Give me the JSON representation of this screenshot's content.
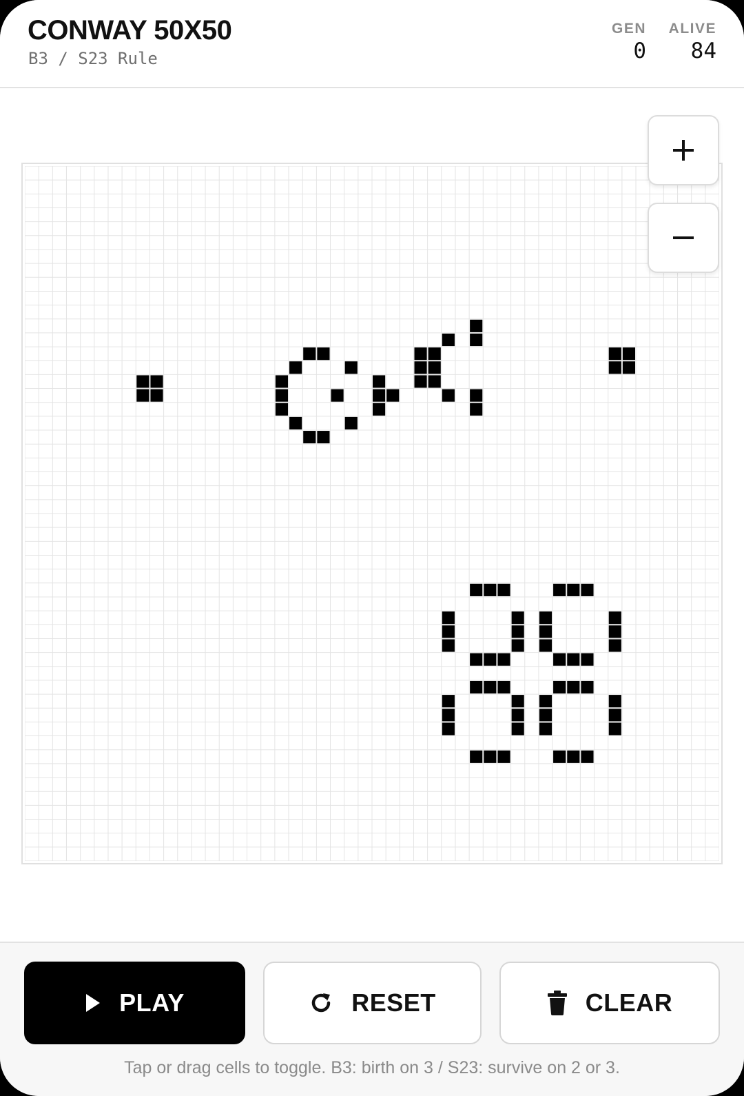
{
  "header": {
    "title": "CONWAY 50X50",
    "subtitle": "B3 / S23 Rule",
    "stats": {
      "gen_label": "GEN",
      "gen_value": "0",
      "alive_label": "ALIVE",
      "alive_value": "84"
    }
  },
  "board": {
    "cols": 50,
    "rows": 50,
    "alive_color": "#000000",
    "grid_color": "#e4e4e4",
    "live_cells": [
      [
        8,
        15
      ],
      [
        8,
        16
      ],
      [
        9,
        15
      ],
      [
        9,
        16
      ],
      [
        20,
        13
      ],
      [
        21,
        13
      ],
      [
        19,
        14
      ],
      [
        23,
        14
      ],
      [
        18,
        15
      ],
      [
        25,
        15
      ],
      [
        18,
        16
      ],
      [
        22,
        16
      ],
      [
        25,
        16
      ],
      [
        26,
        16
      ],
      [
        18,
        17
      ],
      [
        25,
        17
      ],
      [
        19,
        18
      ],
      [
        23,
        18
      ],
      [
        20,
        19
      ],
      [
        21,
        19
      ],
      [
        32,
        11
      ],
      [
        30,
        12
      ],
      [
        32,
        12
      ],
      [
        28,
        13
      ],
      [
        29,
        13
      ],
      [
        28,
        14
      ],
      [
        29,
        14
      ],
      [
        28,
        15
      ],
      [
        29,
        15
      ],
      [
        30,
        16
      ],
      [
        32,
        16
      ],
      [
        32,
        17
      ],
      [
        42,
        13
      ],
      [
        43,
        13
      ],
      [
        42,
        14
      ],
      [
        43,
        14
      ],
      [
        32,
        30
      ],
      [
        33,
        30
      ],
      [
        34,
        30
      ],
      [
        38,
        30
      ],
      [
        39,
        30
      ],
      [
        40,
        30
      ],
      [
        30,
        32
      ],
      [
        35,
        32
      ],
      [
        37,
        32
      ],
      [
        42,
        32
      ],
      [
        30,
        33
      ],
      [
        35,
        33
      ],
      [
        37,
        33
      ],
      [
        42,
        33
      ],
      [
        30,
        34
      ],
      [
        35,
        34
      ],
      [
        37,
        34
      ],
      [
        42,
        34
      ],
      [
        32,
        35
      ],
      [
        33,
        35
      ],
      [
        34,
        35
      ],
      [
        38,
        35
      ],
      [
        39,
        35
      ],
      [
        40,
        35
      ],
      [
        32,
        37
      ],
      [
        33,
        37
      ],
      [
        34,
        37
      ],
      [
        38,
        37
      ],
      [
        39,
        37
      ],
      [
        40,
        37
      ],
      [
        30,
        38
      ],
      [
        35,
        38
      ],
      [
        37,
        38
      ],
      [
        42,
        38
      ],
      [
        30,
        39
      ],
      [
        35,
        39
      ],
      [
        37,
        39
      ],
      [
        42,
        39
      ],
      [
        30,
        40
      ],
      [
        35,
        40
      ],
      [
        37,
        40
      ],
      [
        42,
        40
      ],
      [
        32,
        42
      ],
      [
        33,
        42
      ],
      [
        34,
        42
      ],
      [
        38,
        42
      ],
      [
        39,
        42
      ],
      [
        40,
        42
      ]
    ]
  },
  "zoom": {
    "in_icon": "plus-icon",
    "out_icon": "minus-icon"
  },
  "controls": {
    "play_label": "PLAY",
    "play_icon": "play-icon",
    "reset_label": "RESET",
    "reset_icon": "refresh-icon",
    "clear_label": "CLEAR",
    "clear_icon": "trash-icon"
  },
  "hint": "Tap or drag cells to toggle. B3: birth on 3 / S23: survive on 2 or 3."
}
